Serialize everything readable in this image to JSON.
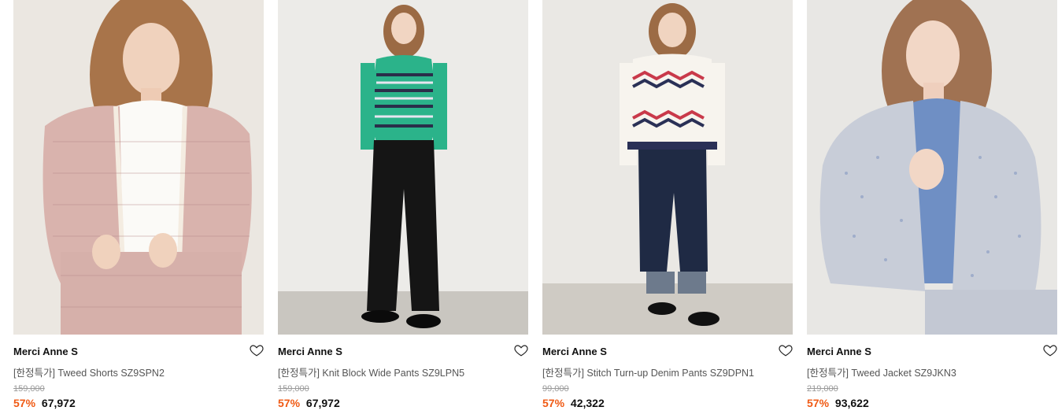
{
  "colors": {
    "discount": "#f05a14",
    "original_price": "#9a9a9a",
    "product_name": "#555555",
    "brand": "#111111"
  },
  "products": [
    {
      "brand": "Merci Anne S",
      "name": "[한정특가] Tweed Shorts SZ9SPN2",
      "original_price": "159,000",
      "discount": "57%",
      "sale_price": "67,972",
      "image": "woman in pink tweed jacket and shorts",
      "wishlist_icon": "heart-outline-icon"
    },
    {
      "brand": "Merci Anne S",
      "name": "[한정특가] Knit Block Wide Pants SZ9LPN5",
      "original_price": "159,000",
      "discount": "57%",
      "sale_price": "67,972",
      "image": "woman in green striped knit and black wide pants",
      "wishlist_icon": "heart-outline-icon"
    },
    {
      "brand": "Merci Anne S",
      "name": "[한정특가] Stitch Turn-up Denim Pants SZ9DPN1",
      "original_price": "99,000",
      "discount": "57%",
      "sale_price": "42,322",
      "image": "woman in patterned cardigan and turn-up denim",
      "wishlist_icon": "heart-outline-icon"
    },
    {
      "brand": "Merci Anne S",
      "name": "[한정특가] Tweed Jacket SZ9JKN3",
      "original_price": "219,000",
      "discount": "57%",
      "sale_price": "93,622",
      "image": "woman in grey-blue tweed jacket",
      "wishlist_icon": "heart-outline-icon"
    }
  ]
}
